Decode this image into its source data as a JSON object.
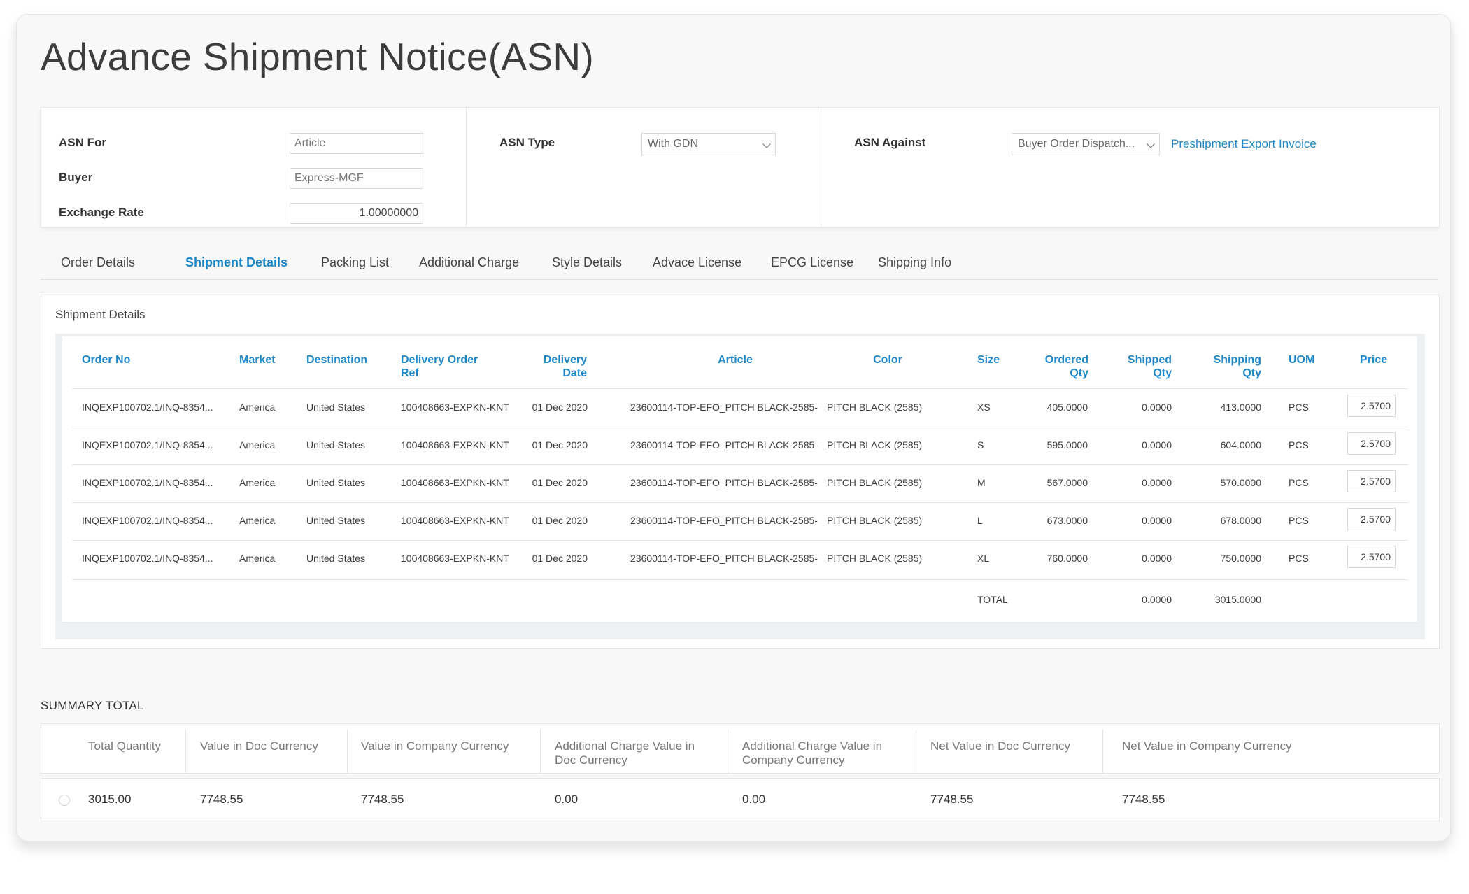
{
  "page": {
    "title": "Advance Shipment Notice(ASN)"
  },
  "form": {
    "asn_for": {
      "label": "ASN For",
      "placeholder": "Article"
    },
    "buyer": {
      "label": "Buyer",
      "placeholder": "Express-MGF"
    },
    "exchange_rate": {
      "label": "Exchange Rate",
      "value": "1.00000000"
    },
    "asn_type": {
      "label": "ASN Type",
      "value": "With GDN"
    },
    "asn_against": {
      "label": "ASN Against",
      "value": "Buyer Order Dispatch..."
    },
    "preshipment_link": "Preshipment Export Invoice"
  },
  "tabs": [
    {
      "label": "Order Details",
      "active": false
    },
    {
      "label": "Shipment Details",
      "active": true
    },
    {
      "label": "Packing List",
      "active": false
    },
    {
      "label": "Additional Charge",
      "active": false
    },
    {
      "label": "Style Details",
      "active": false
    },
    {
      "label": "Advace License",
      "active": false
    },
    {
      "label": "EPCG License",
      "active": false
    },
    {
      "label": "Shipping Info",
      "active": false
    }
  ],
  "shipment": {
    "title": "Shipment Details",
    "headers": {
      "order_no": "Order No",
      "market": "Market",
      "destination": "Destination",
      "delivery_order_ref_1": "Delivery Order",
      "delivery_order_ref_2": "Ref",
      "delivery_date_1": "Delivery",
      "delivery_date_2": "Date",
      "article": "Article",
      "color": "Color",
      "size": "Size",
      "ordered_1": "Ordered",
      "ordered_2": "Qty",
      "shipped_1": "Shipped",
      "shipped_2": "Qty",
      "shipping_1": "Shipping",
      "shipping_2": "Qty",
      "uom": "UOM",
      "price": "Price"
    },
    "rows": [
      {
        "order_no": "INQEXP100702.1/INQ-8354...",
        "market": "America",
        "destination": "United States",
        "ref": "100408663-EXPKN-KNT",
        "date": "01 Dec 2020",
        "article": "23600114-TOP-EFO_PITCH BLACK-2585-",
        "color": "PITCH BLACK (2585)",
        "size": "XS",
        "ordered": "405.0000",
        "shipped": "0.0000",
        "shipping": "413.0000",
        "uom": "PCS",
        "price": "2.5700"
      },
      {
        "order_no": "INQEXP100702.1/INQ-8354...",
        "market": "America",
        "destination": "United States",
        "ref": "100408663-EXPKN-KNT",
        "date": "01 Dec 2020",
        "article": "23600114-TOP-EFO_PITCH BLACK-2585-",
        "color": "PITCH BLACK (2585)",
        "size": "S",
        "ordered": "595.0000",
        "shipped": "0.0000",
        "shipping": "604.0000",
        "uom": "PCS",
        "price": "2.5700"
      },
      {
        "order_no": "INQEXP100702.1/INQ-8354...",
        "market": "America",
        "destination": "United States",
        "ref": "100408663-EXPKN-KNT",
        "date": "01 Dec 2020",
        "article": "23600114-TOP-EFO_PITCH BLACK-2585-",
        "color": "PITCH BLACK (2585)",
        "size": "M",
        "ordered": "567.0000",
        "shipped": "0.0000",
        "shipping": "570.0000",
        "uom": "PCS",
        "price": "2.5700"
      },
      {
        "order_no": "INQEXP100702.1/INQ-8354...",
        "market": "America",
        "destination": "United States",
        "ref": "100408663-EXPKN-KNT",
        "date": "01 Dec 2020",
        "article": "23600114-TOP-EFO_PITCH BLACK-2585-",
        "color": "PITCH BLACK (2585)",
        "size": "L",
        "ordered": "673.0000",
        "shipped": "0.0000",
        "shipping": "678.0000",
        "uom": "PCS",
        "price": "2.5700"
      },
      {
        "order_no": "INQEXP100702.1/INQ-8354...",
        "market": "America",
        "destination": "United States",
        "ref": "100408663-EXPKN-KNT",
        "date": "01 Dec 2020",
        "article": "23600114-TOP-EFO_PITCH BLACK-2585-",
        "color": "PITCH BLACK (2585)",
        "size": "XL",
        "ordered": "760.0000",
        "shipped": "0.0000",
        "shipping": "750.0000",
        "uom": "PCS",
        "price": "2.5700"
      }
    ],
    "total": {
      "label": "TOTAL",
      "shipped": "0.0000",
      "shipping": "3015.0000"
    }
  },
  "summary": {
    "title": "SUMMARY TOTAL",
    "headers": {
      "total_qty": "Total Quantity",
      "value_doc": "Value in Doc Currency",
      "value_company": "Value in Company Currency",
      "addl_doc_1": "Additional Charge Value in",
      "addl_doc_2": "Doc Currency",
      "addl_company_1": "Additional Charge Value in",
      "addl_company_2": "Company Currency",
      "net_doc": "Net Value in Doc Currency",
      "net_company": "Net Value in Company Currency"
    },
    "values": {
      "total_qty": "3015.00",
      "value_doc": "7748.55",
      "value_company": "7748.55",
      "addl_doc": "0.00",
      "addl_company": "0.00",
      "net_doc": "7748.55",
      "net_company": "7748.55"
    }
  },
  "colors": {
    "accent": "#1f88c8",
    "background": "#f8f8f8"
  }
}
